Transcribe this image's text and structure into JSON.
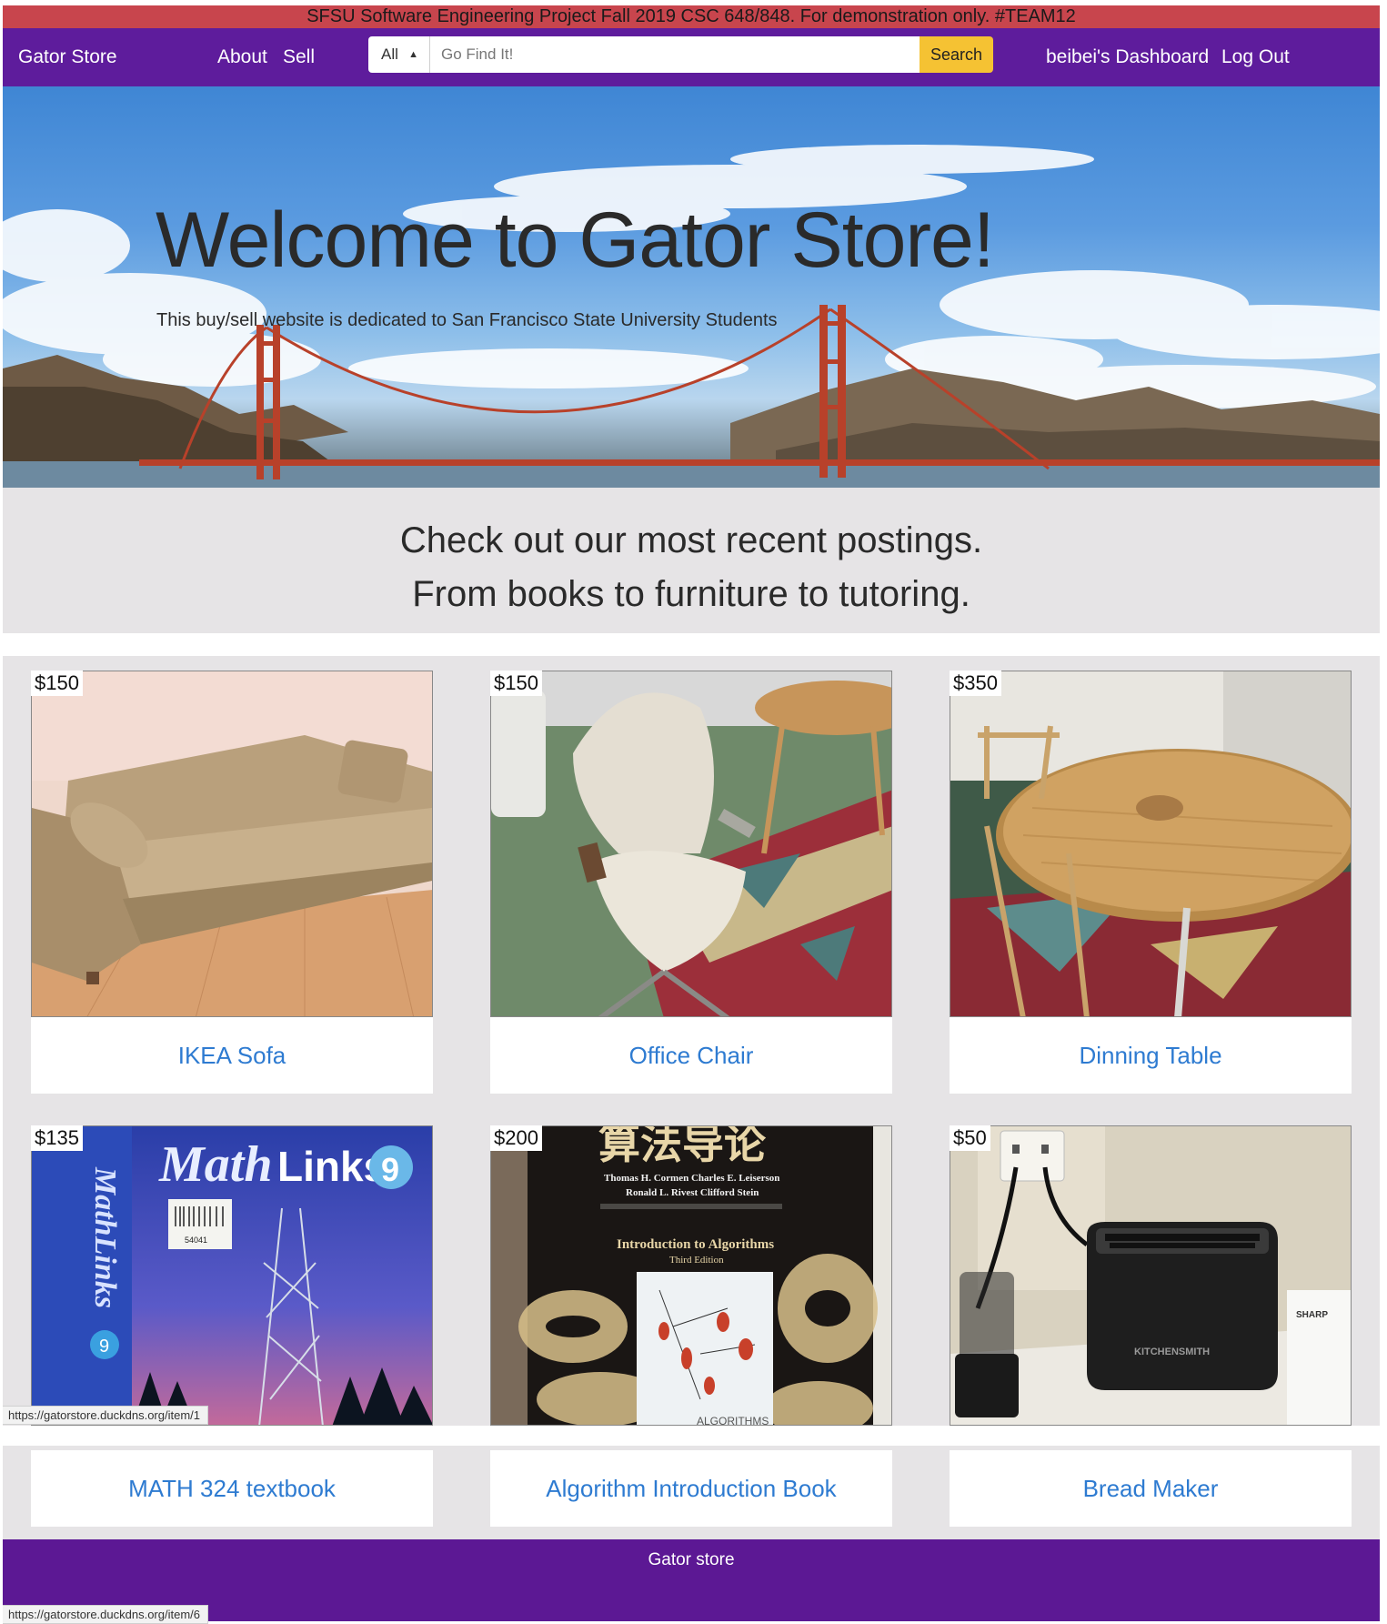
{
  "banner": {
    "text": "SFSU Software Engineering Project Fall 2019 CSC 648/848. For demonstration only. #TEAM12"
  },
  "nav": {
    "brand": "Gator Store",
    "about": "About",
    "sell": "Sell",
    "category_selected": "All",
    "search_placeholder": "Go Find It!",
    "search_value": "",
    "search_button": "Search",
    "dashboard": "beibei's Dashboard",
    "logout": "Log Out"
  },
  "hero": {
    "title": "Welcome to Gator Store!",
    "subtitle": "This buy/sell website is dedicated to San Francisco State University Students"
  },
  "recent": {
    "line1": "Check out our most recent postings.",
    "line2": "From books to furniture to tutoring."
  },
  "listings": [
    {
      "price": "$150",
      "title": "IKEA Sofa"
    },
    {
      "price": "$150",
      "title": "Office Chair"
    },
    {
      "price": "$350",
      "title": "Dinning Table"
    },
    {
      "price": "$135",
      "title": "MATH 324 textbook"
    },
    {
      "price": "$200",
      "title": "Algorithm Introduction Book"
    },
    {
      "price": "$50",
      "title": "Bread Maker"
    }
  ],
  "image_text": {
    "math_book_title_a": "Math",
    "math_book_title_b": "Links",
    "math_book_number": "9",
    "math_book_spine": "MathLinks",
    "math_book_barcode": "54041",
    "algo_cn_title": "算法导论",
    "algo_authors_1": "Thomas H. Cormen  Charles E. Leiserson",
    "algo_authors_2": "Ronald L. Rivest  Clifford Stein",
    "algo_title": "Introduction to Algorithms",
    "algo_edition": "Third Edition",
    "algo_cover_small": "ALGORITHMS",
    "toaster_brand": "KITCHENSMITH",
    "box_brand": "SHARP"
  },
  "footer": {
    "text": "Gator store"
  },
  "status_bar": {
    "url_1": "https://gatorstore.duckdns.org/item/1",
    "url_2": "https://gatorstore.duckdns.org/item/6"
  },
  "colors": {
    "banner": "#c8454d",
    "navbar": "#5e1c9c",
    "search_button": "#f5c233",
    "link": "#2e7bd1",
    "footer": "#5c1894",
    "section_bg": "#e6e4e6"
  }
}
